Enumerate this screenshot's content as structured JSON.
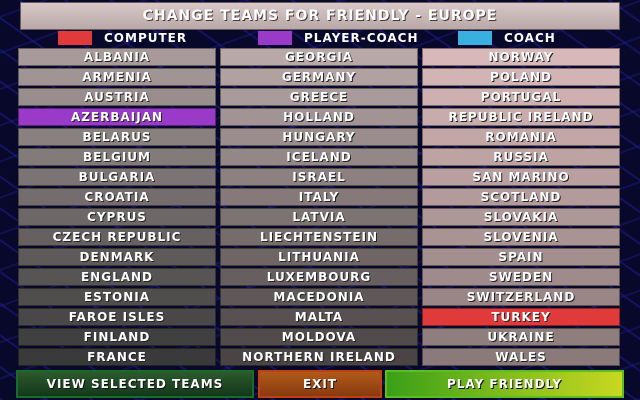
{
  "title": "CHANGE TEAMS FOR FRIENDLY - EUROPE",
  "legend": [
    {
      "label": "COMPUTER",
      "color": "#e03a3a"
    },
    {
      "label": "PLAYER-COACH",
      "color": "#9a3ac8"
    },
    {
      "label": "COACH",
      "color": "#3ab0e0"
    }
  ],
  "columns": [
    [
      "ALBANIA",
      "ARMENIA",
      "AUSTRIA",
      "AZERBAIJAN",
      "BELARUS",
      "BELGIUM",
      "BULGARIA",
      "CROATIA",
      "CYPRUS",
      "CZECH REPUBLIC",
      "DENMARK",
      "ENGLAND",
      "ESTONIA",
      "FAROE ISLES",
      "FINLAND",
      "FRANCE"
    ],
    [
      "GEORGIA",
      "GERMANY",
      "GREECE",
      "HOLLAND",
      "HUNGARY",
      "ICELAND",
      "ISRAEL",
      "ITALY",
      "LATVIA",
      "LIECHTENSTEIN",
      "LITHUANIA",
      "LUXEMBOURG",
      "MACEDONIA",
      "MALTA",
      "MOLDOVA",
      "NORTHERN IRELAND"
    ],
    [
      "NORWAY",
      "POLAND",
      "PORTUGAL",
      "REPUBLIC IRELAND",
      "ROMANIA",
      "RUSSIA",
      "SAN MARINO",
      "SCOTLAND",
      "SLOVAKIA",
      "SLOVENIA",
      "SPAIN",
      "SWEDEN",
      "SWITZERLAND",
      "TURKEY",
      "UKRAINE",
      "WALES"
    ]
  ],
  "selected": {
    "AZERBAIJAN": "player-coach",
    "TURKEY": "computer"
  },
  "buttons": {
    "view": "VIEW SELECTED TEAMS",
    "exit": "EXIT",
    "play": "PLAY FRIENDLY"
  }
}
